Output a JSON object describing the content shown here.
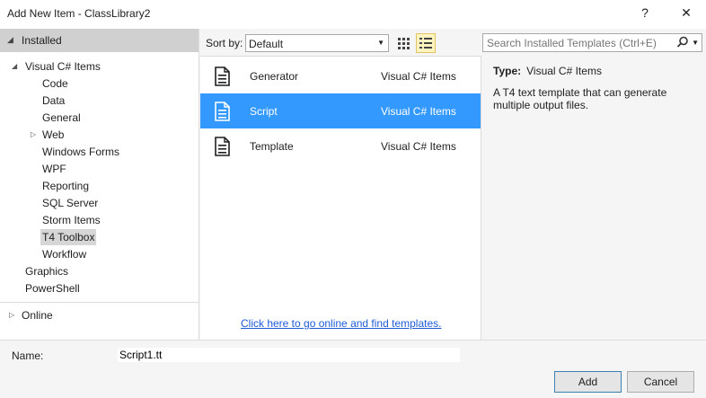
{
  "window": {
    "title": "Add New Item - ClassLibrary2",
    "help": "?",
    "close": "✕"
  },
  "left_panel": {
    "installed_label": "Installed",
    "root_label": "Visual C# Items",
    "children": [
      "Code",
      "Data",
      "General",
      "Web",
      "Windows Forms",
      "WPF",
      "Reporting",
      "SQL Server",
      "Storm Items",
      "T4 Toolbox",
      "Workflow"
    ],
    "selected_child": "T4 Toolbox",
    "siblings": [
      "Graphics",
      "PowerShell"
    ],
    "online_label": "Online"
  },
  "toolbar": {
    "sort_label": "Sort by:",
    "sort_value": "Default"
  },
  "templates": [
    {
      "name": "Generator",
      "category": "Visual C# Items",
      "selected": false
    },
    {
      "name": "Script",
      "category": "Visual C# Items",
      "selected": true
    },
    {
      "name": "Template",
      "category": "Visual C# Items",
      "selected": false
    }
  ],
  "online_link": "Click here to go online and find templates.",
  "search": {
    "placeholder": "Search Installed Templates (Ctrl+E)"
  },
  "details": {
    "type_label": "Type:",
    "type_value": "Visual C# Items",
    "description": "A T4 text template that can generate multiple output files."
  },
  "footer": {
    "name_label": "Name:",
    "name_value": "Script1.tt",
    "add_label": "Add",
    "cancel_label": "Cancel"
  },
  "colors": {
    "selection": "#3399ff",
    "link": "#1e5bd6",
    "installed_header": "#d0d0d0"
  },
  "icons": [
    "help-icon",
    "close-icon",
    "collapse-triangle-icon",
    "expand-arrow-icon",
    "grid-view-icon",
    "list-view-icon",
    "document-icon",
    "search-icon",
    "chevron-down-icon"
  ]
}
